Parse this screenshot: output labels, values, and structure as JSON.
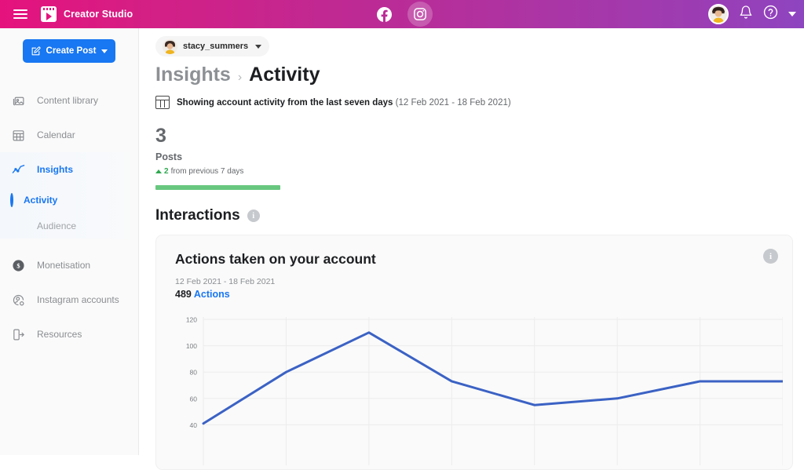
{
  "topbar": {
    "menu_icon": "hamburger-icon",
    "brand": "Creator Studio",
    "platforms": [
      {
        "name": "facebook-icon",
        "active": false
      },
      {
        "name": "instagram-icon",
        "active": true
      }
    ],
    "notifications_icon": "bell-icon",
    "help_icon": "help-circle-icon",
    "account_caret": "chevron-down-icon"
  },
  "sidebar": {
    "create_post": "Create Post",
    "items": [
      {
        "label": "Content library",
        "icon": "content-library-icon",
        "active": false
      },
      {
        "label": "Calendar",
        "icon": "calendar-icon",
        "active": false
      },
      {
        "label": "Insights",
        "icon": "insights-chart-icon",
        "active": true
      },
      {
        "label": "Monetisation",
        "icon": "dollar-coin-icon",
        "active": false
      },
      {
        "label": "Instagram accounts",
        "icon": "account-settings-icon",
        "active": false
      },
      {
        "label": "Resources",
        "icon": "resources-exit-icon",
        "active": false
      }
    ],
    "sub_items": [
      {
        "label": "Activity",
        "active": true
      },
      {
        "label": "Audience",
        "active": false
      }
    ]
  },
  "main": {
    "account_chip": {
      "name": "stacy_summers",
      "caret": "chevron-down-icon"
    },
    "breadcrumb": {
      "parent": "Insights",
      "separator": "›",
      "current": "Activity"
    },
    "subline": {
      "icon": "calendar-icon",
      "bold_text": "Showing account activity from the last seven days",
      "range_text": "(12 Feb 2021 - 18 Feb 2021)"
    },
    "stat": {
      "value": "3",
      "label": "Posts",
      "delta_value": "2",
      "delta_text": "from previous 7 days",
      "delta_direction": "up",
      "bar_color": "#68c77f"
    },
    "section": {
      "title": "Interactions",
      "info_icon": "info-icon",
      "info_glyph": "i"
    }
  },
  "card": {
    "title": "Actions taken on your account",
    "range": "12 Feb 2021 - 18 Feb 2021",
    "metric_value": "489",
    "metric_unit": "Actions",
    "info_glyph": "i"
  },
  "chart_data": {
    "type": "line",
    "title": "Actions taken on your account",
    "subtitle": "12 Feb 2021 - 18 Feb 2021",
    "total_label": "489 Actions",
    "xlabel": "",
    "ylabel": "",
    "ylim": [
      20,
      120
    ],
    "yticks": [
      120,
      100,
      80,
      60,
      40
    ],
    "xticks": [
      "",
      "",
      "",
      "",
      "",
      "",
      ""
    ],
    "grid": true,
    "legend": "none",
    "line_color": "#3b62c4",
    "series": [
      {
        "name": "Actions",
        "x": [
          0,
          1,
          2,
          3,
          4,
          5,
          6,
          7
        ],
        "values": [
          41,
          80,
          110,
          73,
          55,
          60,
          73,
          73
        ]
      }
    ]
  }
}
